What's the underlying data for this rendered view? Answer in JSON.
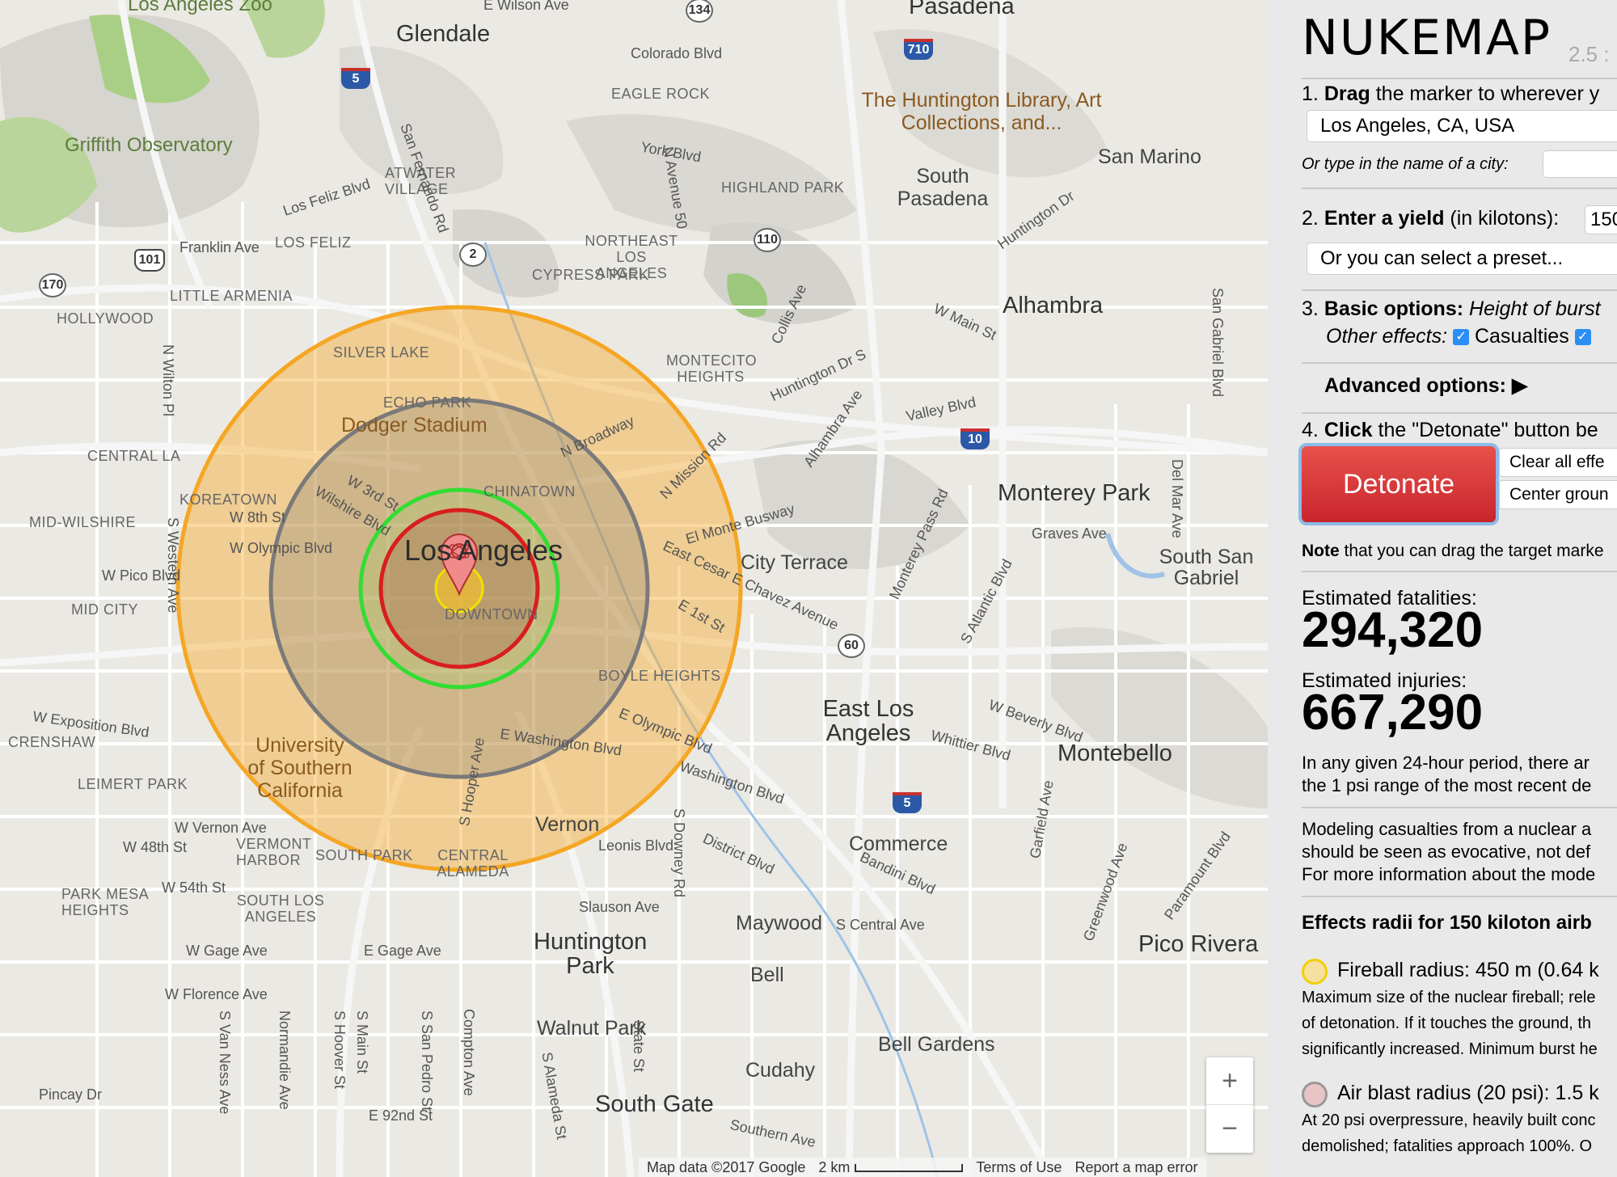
{
  "map": {
    "cities_big": [
      {
        "name": "Glendale"
      },
      {
        "name": "Los Angeles"
      },
      {
        "name": "Pasadena"
      },
      {
        "name": "Alhambra"
      },
      {
        "name": "Monterey Park"
      },
      {
        "name": "East Los Angeles"
      },
      {
        "name": "Montebello"
      },
      {
        "name": "Commerce"
      },
      {
        "name": "Huntington Park"
      },
      {
        "name": "Bell"
      },
      {
        "name": "Pico Rivera"
      },
      {
        "name": "Bell Gardens"
      },
      {
        "name": "South Gate"
      },
      {
        "name": "Vernon"
      },
      {
        "name": "Maywood"
      },
      {
        "name": "Cudahy"
      },
      {
        "name": "Walnut Park"
      },
      {
        "name": "South Pasadena"
      },
      {
        "name": "San Marino"
      },
      {
        "name": "South San Gabriel"
      },
      {
        "name": "City Terrace"
      }
    ],
    "neighborhoods": [
      "HOLLYWOOD",
      "LITTLE ARMENIA",
      "LOS FELIZ",
      "ATWATER VILLAGE",
      "EAGLE ROCK",
      "HIGHLAND PARK",
      "NORTHEAST LOS ANGELES",
      "CYPRESS PARK",
      "SILVER LAKE",
      "ECHO PARK",
      "MONTECITO HEIGHTS",
      "CENTRAL LA",
      "KOREATOWN",
      "MID-WILSHIRE",
      "MID CITY",
      "CHINATOWN",
      "DOWNTOWN",
      "BOYLE HEIGHTS",
      "CRENSHAW",
      "LEIMERT PARK",
      "VERMONT HARBOR",
      "SOUTH PARK",
      "CENTRAL ALAMEDA",
      "PARK MESA HEIGHTS",
      "SOUTH LOS ANGELES"
    ],
    "pois": [
      "Griffith Observatory",
      "Los Angeles Zoo",
      "Dodger Stadium",
      "University of Southern California",
      "The Huntington Library, Art Collections, and..."
    ],
    "streets": [
      "Colorado Blvd",
      "York Blvd",
      "Los Feliz Blvd",
      "Franklin Ave",
      "W 3rd St",
      "W 8th St",
      "Wilshire Blvd",
      "W Olympic Blvd",
      "W Pico Blvd",
      "W Exposition Blvd",
      "W Vernon Ave",
      "W 48th St",
      "W 54th St",
      "W Gage Ave",
      "E Gage Ave",
      "W Florence Ave",
      "E Washington Blvd",
      "E Olympic Blvd",
      "Washington Blvd",
      "El Monte Busway",
      "East Cesar E Chavez Avenue",
      "E 1st St",
      "N Broadway",
      "N Mission Rd",
      "Valley Blvd",
      "Huntington Dr",
      "W Main St",
      "Graves Ave",
      "W Beverly Blvd",
      "Whittier Blvd",
      "Slauson Ave",
      "Leonis Blvd",
      "District Blvd",
      "Bandini Blvd",
      "E 92nd St",
      "Pincay Dr",
      "N Avenue 50",
      "San Fernando Rd",
      "S Western Ave",
      "N Wilton Pl",
      "S Hooper Ave",
      "S Atlantic Blvd",
      "Garfield Ave",
      "Greenwood Ave",
      "Paramount Blvd",
      "S Downey Rd",
      "Del Mar Ave",
      "San Gabriel Blvd",
      "Monterey Pass Rd",
      "Alhambra Ave",
      "Collis Ave",
      "Huntington Dr S",
      "Southern Ave",
      "S Alameda St",
      "State St",
      "Compton Ave",
      "S Central Ave",
      "S San Pedro St",
      "S Main St",
      "S Hoover St",
      "Normandie Ave",
      "S Van Ness Ave",
      "E Wilson Ave",
      "S Atlantic Blvd 2"
    ],
    "shields": [
      "5",
      "134",
      "710",
      "2",
      "110",
      "101",
      "170",
      "10",
      "60",
      "5"
    ],
    "zoom": {
      "in": "+",
      "out": "−"
    },
    "attribution": {
      "data": "Map data ©2017 Google",
      "scale": "2 km",
      "terms": "Terms of Use",
      "report": "Report a map error"
    }
  },
  "rings": {
    "fireball": {
      "color": "#f2e000",
      "fill": "rgba(255,220,60,0.45)",
      "radius_km": 0.45
    },
    "air_blast_20psi": {
      "color": "#d81e1e",
      "fill": "rgba(150,60,60,0.25)",
      "radius_km": 1.5
    },
    "radiation": {
      "color": "#33cc33",
      "fill": "rgba(120,220,80,0.15)"
    },
    "air_blast_5psi": {
      "color": "#7a7a7a",
      "fill": "rgba(120,120,120,0.22)"
    },
    "thermal": {
      "color": "#f5a623",
      "fill": "rgba(245,166,35,0.40)"
    }
  },
  "panel": {
    "title": "NUKEMAP",
    "version": "2.5 :",
    "step1": {
      "num": "1.",
      "bold": "Drag",
      "rest": " the marker to wherever y",
      "location": "Los Angeles, CA, USA",
      "city_prompt": "Or type in the name of a city:"
    },
    "step2": {
      "num": "2.",
      "bold": "Enter a yield",
      "rest": " (in kilotons):",
      "yield": "150",
      "preset": "Or you can select a preset..."
    },
    "step3": {
      "num": "3.",
      "bold": "Basic options:",
      "italic": " Height of burst",
      "other": "Other effects:",
      "casualties": "Casualties"
    },
    "advanced": "Advanced options:",
    "step4": {
      "num": "4.",
      "bold": "Click",
      "rest": " the \"Detonate\" button be"
    },
    "detonate": "Detonate",
    "clear": "Clear all effe",
    "center": "Center groun",
    "note_bold": "Note",
    "note_rest": " that you can drag the target marke",
    "fatalities_label": "Estimated fatalities:",
    "fatalities": "294,320",
    "injuries_label": "Estimated injuries:",
    "injuries": "667,290",
    "para1": [
      "In any given 24-hour period, there ar",
      "the 1 psi range of the most recent de"
    ],
    "para2": [
      "Modeling casualties from a nuclear a",
      "should be seen as evocative, not def",
      "For more information about the mode"
    ],
    "effects_title": "Effects radii for 150 kiloton airb",
    "fireball_line": "Fireball radius: 450 m (0.64 k",
    "fireball_desc": [
      "Maximum size of the nuclear fireball; rele",
      "of detonation. If it touches the ground, th",
      "significantly increased. Minimum burst he"
    ],
    "airblast_line": "Air blast radius (20 psi): 1.5 k",
    "airblast_desc": [
      "At 20 psi overpressure, heavily built conc",
      "demolished; fatalities approach 100%. O"
    ]
  }
}
